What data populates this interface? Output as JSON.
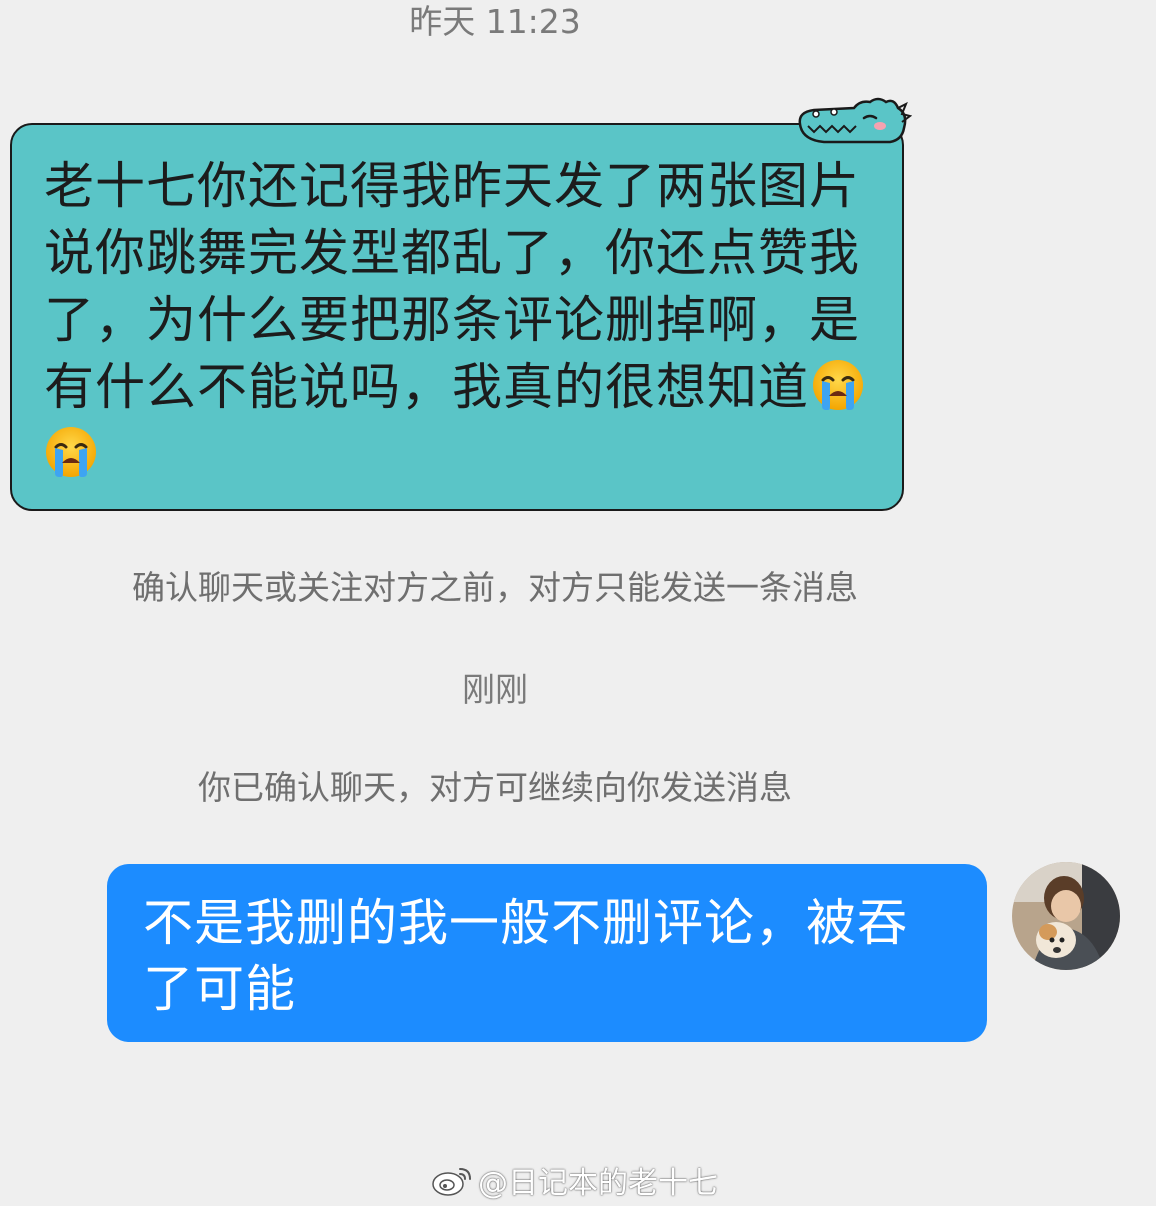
{
  "messages": {
    "timestamp_yesterday": "昨天 11:23",
    "incoming": {
      "text": "老十七你还记得我昨天发了两张图片说你跳舞完发型都乱了，你还点赞我了，为什么要把那条评论删掉啊，是有什么不能说吗，我真的很想知道",
      "emoji": "loudly-crying-face",
      "bubble_color": "#5ac5c7",
      "sticker": "crocodile-sticker"
    },
    "system_note_1": "确认聊天或关注对方之前，对方只能发送一条消息",
    "timestamp_now": "刚刚",
    "system_note_2": "你已确认聊天，对方可继续向你发送消息",
    "outgoing": {
      "text": "不是我删的我一般不删评论，被吞了可能",
      "bubble_color": "#1c8cff"
    }
  },
  "watermark": {
    "logo": "weibo-logo",
    "text": "@日记本的老十七"
  },
  "colors": {
    "background": "#efefef",
    "meta_text": "#7a7a7a"
  }
}
